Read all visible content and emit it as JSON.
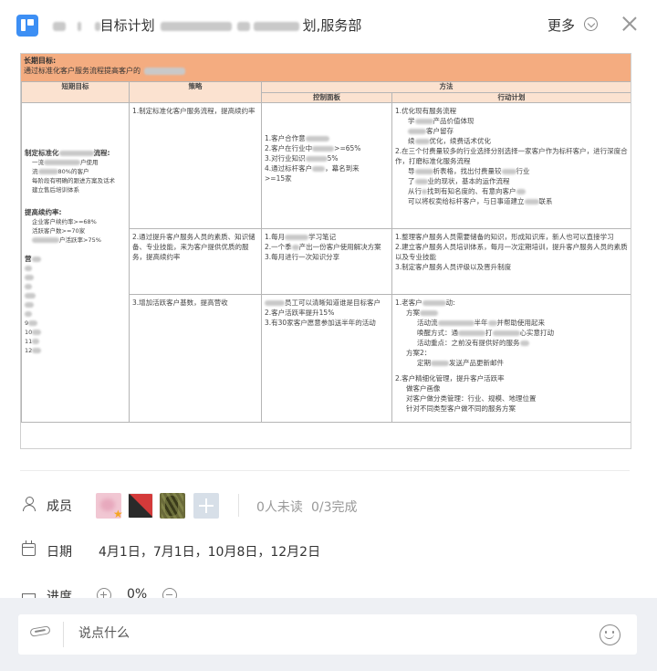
{
  "header": {
    "title_mid": "目标计划",
    "title_end": "划,服务部",
    "more_label": "更多"
  },
  "doc": {
    "long_term_label": "长期目标:",
    "long_term_text": "通过标准化客户服务流程提高客户的",
    "col_short": "短期目标",
    "col_strategy": "策略",
    "col_method": "方法",
    "col_panel": "控制面板",
    "col_action": "行动计划",
    "goals": {
      "g1_title": "制定标准化",
      "g1_title_end": "流程:",
      "g1_sub1": "一流",
      "g1_sub1_end": "户使用",
      "g1_sub2": "流",
      "g1_sub2_end": "80%的客户",
      "g1_sub3": "每阶段有明确的跟进方案及话术",
      "g1_sub4": "建立售后培训体系",
      "g2_title": "提高续约率:",
      "g2_sub1": "企业客户续约率>=68%",
      "g2_sub2": "活跃客户数>=70家",
      "g2_sub3": "",
      "g2_sub3_end": "户活跃率>75%",
      "g3_title": "营",
      "m9": "9",
      "m10": "10",
      "m11": "11",
      "m12": "12"
    },
    "rows": [
      {
        "strategy": "1.制定标准化客户服务流程，提高续约率",
        "panel": [
          "1.客户合作意",
          "2.客户在行业中",
          ">=65%",
          "3.对行业知识",
          "5%",
          "4.通过标杆客户",
          "，幕名到来",
          ">=15家"
        ],
        "action": [
          "1.优化现有服务流程",
          "学",
          "产品价值体现",
          "客户留存",
          "续",
          "优化，续费话术优化",
          "2.在三个付费量较多的行业选择分别选择一家客户作为标杆客户，进行深度合作，打磨标准化服务流程",
          "导",
          "析表格，找出付费量较",
          "行业",
          "了",
          "业的现状，基本的运作流程",
          "从行",
          "找到有知名度的、有意向客户",
          "可以将权卖给标杆客户，与日事道建立",
          "联系"
        ]
      },
      {
        "strategy": "2.通过提升客户服务人员的素质、知识储备、专业技能，来为客户提供优质的服务，提高续约率",
        "panel": [
          "1.每月",
          "学习笔记",
          "2.一个季",
          "产出一份客户使用解决方案",
          "3.每月进行一次知识分享"
        ],
        "action": [
          "1.整理客户服务人员需要储备的知识，形成知识库，新人也可以直接学习",
          "2.建立客户服务人员培训体系，每月一次定期培训，提升客户服务人员的素质以及专业技能",
          "3.制定客户服务人员评级以及晋升制度"
        ]
      },
      {
        "strategy": "3.增加活跃客户基数，提高营收",
        "panel": [
          "员工可以清晰知道谁是目标客户",
          "2.客户活跃率提升15%",
          "3.有30家客户愿意参加送半年的活动"
        ],
        "action": [
          "1.老客户",
          "动:",
          "方案",
          "活动流",
          "半年",
          "并帮助使用起来",
          "唤醒方式：通",
          "打",
          "心实意打动",
          "活动重点：之前没有提供好的服务",
          "方案2：",
          "定期",
          "发送产品更新邮件",
          "2.客户精细化管理，提升客户活跃率",
          "做客户画像",
          "对客户做分类管理：行业、规模、地理位置",
          "针对不同类型客户做不同的服务方案"
        ]
      }
    ]
  },
  "members": {
    "label": "成员",
    "unread": "0人未读",
    "complete": "0/3完成"
  },
  "dates": {
    "label": "日期",
    "value": "4月1日，7月1日，10月8日，12月2日"
  },
  "progress": {
    "label": "进度",
    "value": "0%"
  },
  "chat": {
    "placeholder": "说点什么"
  },
  "colors": {
    "accent": "#3d8ff4",
    "banner": "#f4ac80",
    "header_cell": "#fbe2d0",
    "footer_bg": "#eef0f4",
    "star": "#f5a623"
  }
}
